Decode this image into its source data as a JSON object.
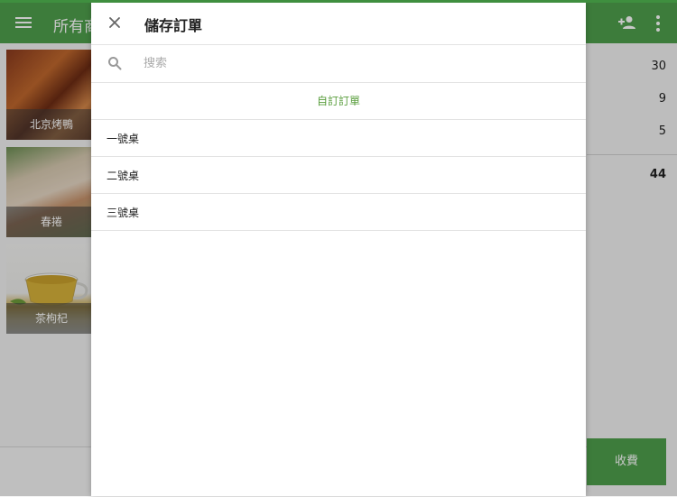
{
  "app_bar": {
    "title": "所有商品",
    "icons": [
      "menu-icon",
      "add-person-icon",
      "more-vert-icon"
    ]
  },
  "products": [
    {
      "label": "北京烤鴨"
    },
    {
      "label": "春捲"
    },
    {
      "label": "茶枸杞"
    }
  ],
  "order_panel": {
    "counts": [
      "30",
      "9",
      "5"
    ],
    "total": "44",
    "charge_label": "收費"
  },
  "dialog": {
    "title": "儲存訂單",
    "search": {
      "placeholder": "搜索",
      "value": ""
    },
    "custom_order_label": "自訂訂單",
    "orders": [
      {
        "label": "一號桌"
      },
      {
        "label": "二號桌"
      },
      {
        "label": "三號桌"
      }
    ]
  },
  "colors": {
    "brand_green": "#4f9f4c",
    "accent_text_green": "#5a9e3e"
  }
}
